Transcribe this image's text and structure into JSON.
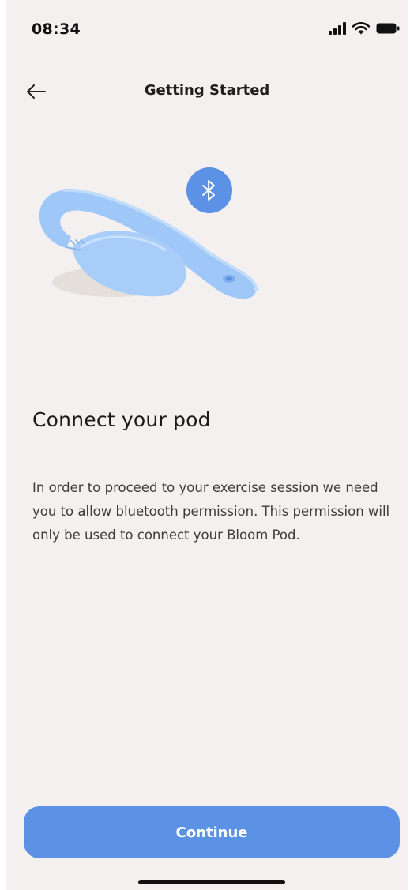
{
  "status_bar": {
    "time": "08:34",
    "icons": [
      "cellular-signal-icon",
      "wifi-icon",
      "battery-icon"
    ]
  },
  "nav": {
    "title": "Getting Started",
    "back_icon": "arrow-left-icon"
  },
  "illustration": {
    "subject": "pod-device-icon",
    "badge_icon": "bluetooth-icon"
  },
  "content": {
    "headline": "Connect your pod",
    "body": "In order to proceed to your exercise session we need you to allow bluetooth permission. This permission will only be used to connect your Bloom Pod."
  },
  "actions": {
    "continue_label": "Continue"
  },
  "colors": {
    "accent": "#5b92e6",
    "background": "#f4f0ef",
    "device": "#a9cdf9"
  }
}
